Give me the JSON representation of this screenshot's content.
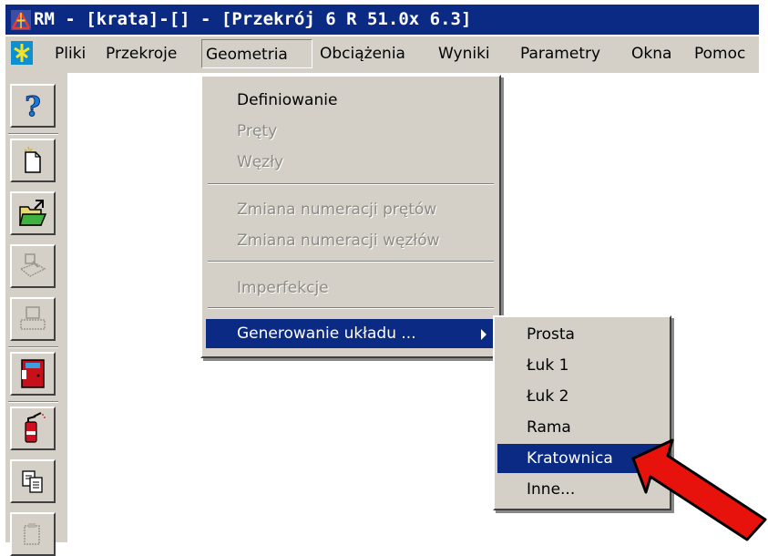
{
  "window": {
    "title": "RM - [krata]-[] - [Przekrój 6 R 51.0x 6.3]"
  },
  "menubar": {
    "items": [
      {
        "label": "Pliki"
      },
      {
        "label": "Przekroje"
      },
      {
        "label": "Geometria"
      },
      {
        "label": "Obciążenia"
      },
      {
        "label": "Wyniki"
      },
      {
        "label": "Parametry"
      },
      {
        "label": "Okna"
      },
      {
        "label": "Pomoc"
      }
    ]
  },
  "toolbar": {
    "buttons": [
      {
        "icon": "help-icon"
      },
      {
        "icon": "new-file-icon"
      },
      {
        "icon": "open-folder-icon"
      },
      {
        "icon": "print-preview-icon"
      },
      {
        "icon": "print-icon"
      },
      {
        "icon": "exit-door-icon"
      },
      {
        "icon": "fire-extinguisher-icon"
      },
      {
        "icon": "copy-icon"
      },
      {
        "icon": "paste-icon"
      }
    ]
  },
  "geometria_menu": {
    "items": [
      {
        "label": "Definiowanie",
        "enabled": true
      },
      {
        "label": "Pręty",
        "enabled": false
      },
      {
        "label": "Węzły",
        "enabled": false
      },
      {
        "label": "Zmiana numeracji prętów",
        "enabled": false
      },
      {
        "label": "Zmiana numeracji węzłów",
        "enabled": false
      },
      {
        "label": "Imperfekcje",
        "enabled": false
      },
      {
        "label": "Generowanie układu ...",
        "enabled": true,
        "selected": true
      }
    ]
  },
  "submenu": {
    "items": [
      {
        "label": "Prosta"
      },
      {
        "label": "Łuk 1"
      },
      {
        "label": "Łuk 2"
      },
      {
        "label": "Rama"
      },
      {
        "label": "Kratownica",
        "selected": true
      },
      {
        "label": "Inne..."
      }
    ]
  },
  "colors": {
    "title_bar": "#0b2a84",
    "selection": "#0b2a84",
    "face": "#d4d0c8",
    "disabled_text": "#8e8b84",
    "annotation_arrow": "#e8120c"
  }
}
